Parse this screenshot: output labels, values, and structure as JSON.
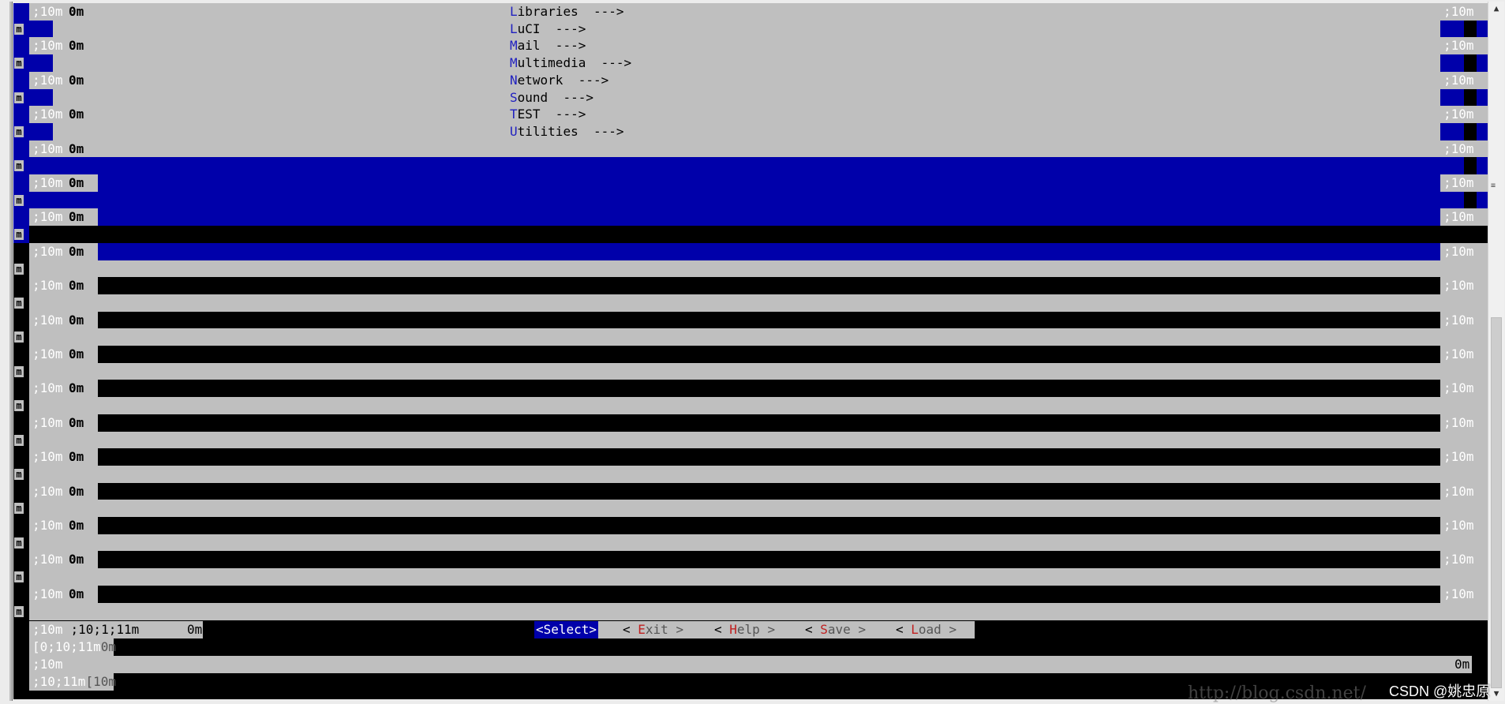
{
  "terminal": {
    "escape_left": ";10m",
    "escape_right": ";10m",
    "zero_m": "0m",
    "m_mark": "m",
    "menu_items": [
      {
        "hotkey": "L",
        "rest": "ibraries  --->"
      },
      {
        "hotkey": "L",
        "rest": "uCI  --->"
      },
      {
        "hotkey": "M",
        "rest": "ail  --->"
      },
      {
        "hotkey": "M",
        "rest": "ultimedia  --->"
      },
      {
        "hotkey": "N",
        "rest": "etwork  --->"
      },
      {
        "hotkey": "S",
        "rest": "ound  --->"
      },
      {
        "hotkey": "T",
        "rest": "EST  --->"
      },
      {
        "hotkey": "U",
        "rest": "tilities  --->"
      }
    ],
    "bottom_left_codes": ";10;1;11m",
    "bottom_zero": "0m",
    "line2_code": "[0;10;11m",
    "line2_zero": "0m",
    "line3_code": ";10m",
    "line3_zero": "0m",
    "line4_code": ";10;11m",
    "line4_suffix": "[10m"
  },
  "buttons": {
    "select": "<Select>",
    "exit_open": "< ",
    "exit_hot": "E",
    "exit_rest": "xit >",
    "help_open": "< ",
    "help_hot": "H",
    "help_rest": "elp >",
    "save_open": "< ",
    "save_hot": "S",
    "save_rest": "ave >",
    "load_open": "< ",
    "load_hot": "L",
    "load_rest": "oad >"
  },
  "scrollbar": {
    "up_arrow": "▲",
    "down_arrow": "▼",
    "grip": "≡"
  },
  "watermark": {
    "url": "http://blog.csdn.net/",
    "csdn": "CSDN @姚忠原"
  },
  "colors": {
    "dialog_gray": "#bfbfbf",
    "highlight_blue": "#0000aa",
    "hotkey_blue": "#2020c0",
    "hotkey_red": "#c02020"
  }
}
